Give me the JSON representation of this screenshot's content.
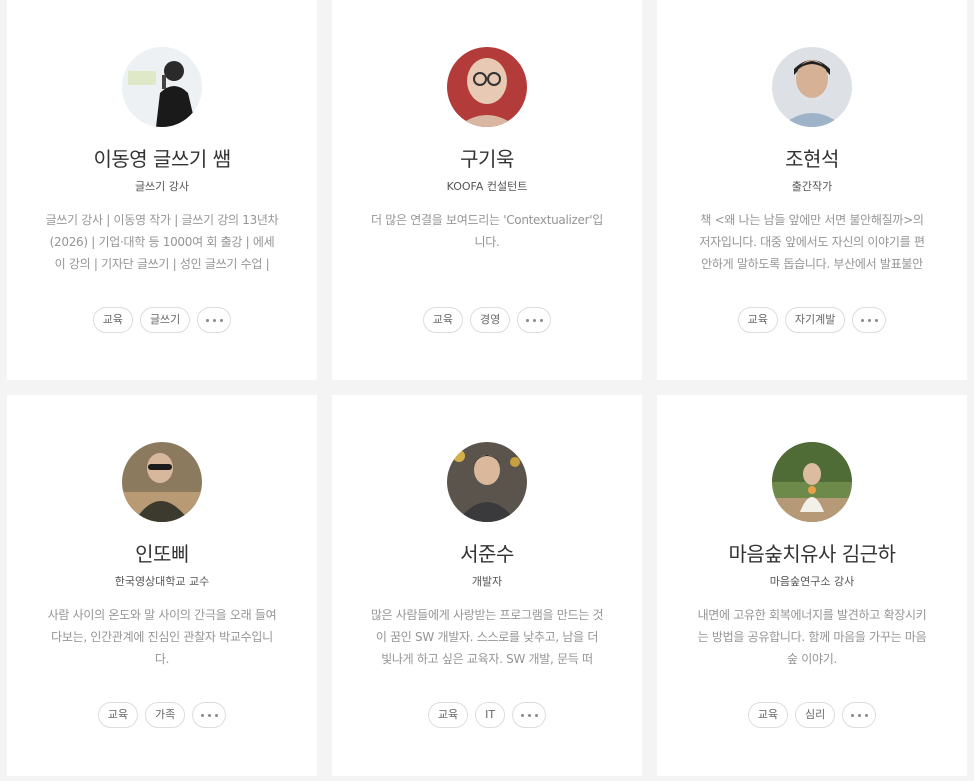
{
  "authors": [
    {
      "name": "이동영 글쓰기 쌤",
      "role": "글쓰기 강사",
      "description": "글쓰기 강사 | 이동영 작가 | 글쓰기 강의 13년차(2026) | 기업·대학 등 1000여 회 출강 | 에세이 강의 | 기자단 글쓰기 | 성인 글쓰기 수업 |",
      "tags": [
        "교육",
        "글쓰기"
      ],
      "avatar_bg": "#e9eef2"
    },
    {
      "name": "구기욱",
      "role": "KOOFA 컨설턴트",
      "description": "더 많은 연결을 보여드리는 'Contextualizer'입니다.",
      "tags": [
        "교육",
        "경영"
      ],
      "avatar_bg": "#b33b3a"
    },
    {
      "name": "조현석",
      "role": "출간작가",
      "description": "책 <왜 나는 남들 앞에만 서면 불안해질까>의 저자입니다. 대중 앞에서도 자신의 이야기를 편안하게 말하도록 돕습니다. 부산에서 발표불안",
      "tags": [
        "교육",
        "자기계발"
      ],
      "avatar_bg": "#dde1e6"
    },
    {
      "name": "인또삐",
      "role": "한국영상대학교 교수",
      "description": "사람 사이의 온도와 말 사이의 간극을 오래 들여다보는, 인간관계에 진심인 관찰자 박교수입니다.",
      "tags": [
        "교육",
        "가족"
      ],
      "avatar_bg": "#8c7a5e"
    },
    {
      "name": "서준수",
      "role": "개발자",
      "description": "많은 사람들에게 사랑받는 프로그램을 만드는 것이 꿈인 SW 개발자. 스스로를 낮추고, 남을 더 빛나게 하고 싶은 교육자. SW 개발, 문득 떠",
      "tags": [
        "교육",
        "IT"
      ],
      "avatar_bg": "#5b544c"
    },
    {
      "name": "마음숲치유사 김근하",
      "role": "마음숲연구소 강사",
      "description": "내면에 고유한 회복에너지를 발견하고 확장시키는 방법을 공유합니다. 함께 마음을 가꾸는 마음숲 이야기.",
      "tags": [
        "교육",
        "심리"
      ],
      "avatar_bg": "#6d8a4a"
    }
  ]
}
